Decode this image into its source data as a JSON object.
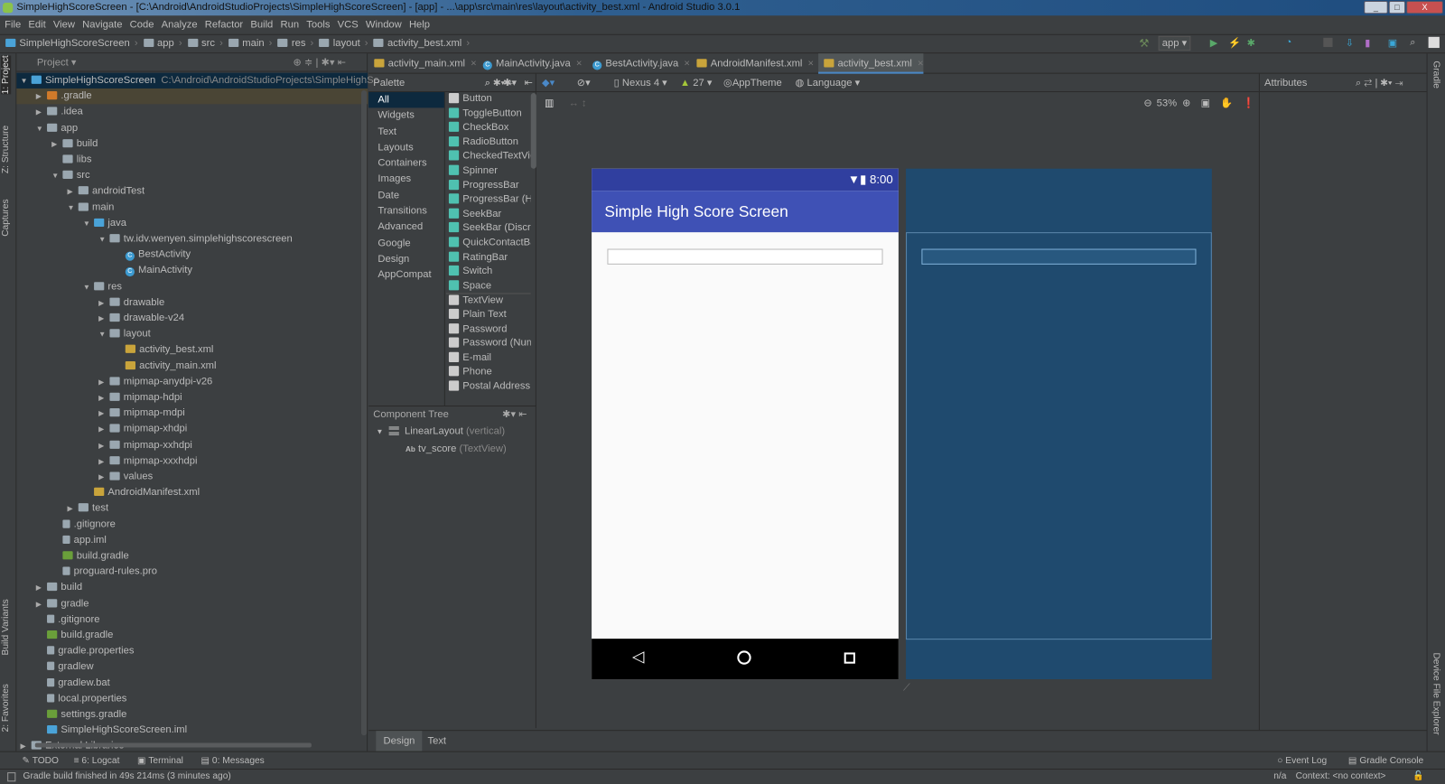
{
  "window": {
    "title": "SimpleHighScoreScreen - [C:\\Android\\AndroidStudioProjects\\SimpleHighScoreScreen] - [app] - ...\\app\\src\\main\\res\\layout\\activity_best.xml - Android Studio 3.0.1",
    "min": "_",
    "max": "□",
    "close": "X"
  },
  "menu": [
    "File",
    "Edit",
    "View",
    "Navigate",
    "Code",
    "Analyze",
    "Refactor",
    "Build",
    "Run",
    "Tools",
    "VCS",
    "Window",
    "Help"
  ],
  "breadcrumb": [
    "SimpleHighScoreScreen",
    "app",
    "src",
    "main",
    "res",
    "layout",
    "activity_best.xml"
  ],
  "toolbar": {
    "run_config": "app ▾"
  },
  "left_stripe": {
    "project": "1: Project",
    "structure": "Z: Structure",
    "captures": "Captures",
    "build_variants": "Build Variants",
    "favorites": "2: Favorites"
  },
  "right_stripe": {
    "gradle": "Gradle",
    "device_file_explorer": "Device File Explorer"
  },
  "project_panel": {
    "title": "Project ▾",
    "tree": [
      {
        "level": 0,
        "tw": "▼",
        "icon": "module",
        "label": "SimpleHighScoreScreen",
        "path": "C:\\Android\\AndroidStudioProjects\\SimpleHighSc",
        "sel": true
      },
      {
        "level": 1,
        "tw": "▶",
        "icon": "folder-orange",
        "label": ".gradle",
        "hl": true
      },
      {
        "level": 1,
        "tw": "▶",
        "icon": "folder",
        "label": ".idea"
      },
      {
        "level": 1,
        "tw": "▼",
        "icon": "folder",
        "label": "app"
      },
      {
        "level": 2,
        "tw": "▶",
        "icon": "folder",
        "label": "build"
      },
      {
        "level": 2,
        "tw": "",
        "icon": "folder",
        "label": "libs"
      },
      {
        "level": 2,
        "tw": "▼",
        "icon": "folder",
        "label": "src"
      },
      {
        "level": 3,
        "tw": "▶",
        "icon": "folder",
        "label": "androidTest"
      },
      {
        "level": 3,
        "tw": "▼",
        "icon": "folder",
        "label": "main"
      },
      {
        "level": 4,
        "tw": "▼",
        "icon": "folder-blue",
        "label": "java"
      },
      {
        "level": 5,
        "tw": "▼",
        "icon": "folder",
        "label": "tw.idv.wenyen.simplehighscorescreen"
      },
      {
        "level": 6,
        "tw": "",
        "icon": "class",
        "label": "BestActivity"
      },
      {
        "level": 6,
        "tw": "",
        "icon": "class",
        "label": "MainActivity"
      },
      {
        "level": 4,
        "tw": "▼",
        "icon": "folder",
        "label": "res"
      },
      {
        "level": 5,
        "tw": "▶",
        "icon": "folder",
        "label": "drawable"
      },
      {
        "level": 5,
        "tw": "▶",
        "icon": "folder",
        "label": "drawable-v24"
      },
      {
        "level": 5,
        "tw": "▼",
        "icon": "folder",
        "label": "layout"
      },
      {
        "level": 6,
        "tw": "",
        "icon": "xml",
        "label": "activity_best.xml"
      },
      {
        "level": 6,
        "tw": "",
        "icon": "xml",
        "label": "activity_main.xml"
      },
      {
        "level": 5,
        "tw": "▶",
        "icon": "folder",
        "label": "mipmap-anydpi-v26"
      },
      {
        "level": 5,
        "tw": "▶",
        "icon": "folder",
        "label": "mipmap-hdpi"
      },
      {
        "level": 5,
        "tw": "▶",
        "icon": "folder",
        "label": "mipmap-mdpi"
      },
      {
        "level": 5,
        "tw": "▶",
        "icon": "folder",
        "label": "mipmap-xhdpi"
      },
      {
        "level": 5,
        "tw": "▶",
        "icon": "folder",
        "label": "mipmap-xxhdpi"
      },
      {
        "level": 5,
        "tw": "▶",
        "icon": "folder",
        "label": "mipmap-xxxhdpi"
      },
      {
        "level": 5,
        "tw": "▶",
        "icon": "folder",
        "label": "values"
      },
      {
        "level": 4,
        "tw": "",
        "icon": "xml",
        "label": "AndroidManifest.xml"
      },
      {
        "level": 3,
        "tw": "▶",
        "icon": "folder",
        "label": "test"
      },
      {
        "level": 2,
        "tw": "",
        "icon": "file",
        "label": ".gitignore"
      },
      {
        "level": 2,
        "tw": "",
        "icon": "file",
        "label": "app.iml"
      },
      {
        "level": 2,
        "tw": "",
        "icon": "gradle",
        "label": "build.gradle"
      },
      {
        "level": 2,
        "tw": "",
        "icon": "file",
        "label": "proguard-rules.pro"
      },
      {
        "level": 1,
        "tw": "▶",
        "icon": "folder",
        "label": "build"
      },
      {
        "level": 1,
        "tw": "▶",
        "icon": "folder",
        "label": "gradle"
      },
      {
        "level": 1,
        "tw": "",
        "icon": "file",
        "label": ".gitignore"
      },
      {
        "level": 1,
        "tw": "",
        "icon": "gradle",
        "label": "build.gradle"
      },
      {
        "level": 1,
        "tw": "",
        "icon": "file",
        "label": "gradle.properties"
      },
      {
        "level": 1,
        "tw": "",
        "icon": "file",
        "label": "gradlew"
      },
      {
        "level": 1,
        "tw": "",
        "icon": "file",
        "label": "gradlew.bat"
      },
      {
        "level": 1,
        "tw": "",
        "icon": "file",
        "label": "local.properties"
      },
      {
        "level": 1,
        "tw": "",
        "icon": "gradle",
        "label": "settings.gradle"
      },
      {
        "level": 1,
        "tw": "",
        "icon": "module",
        "label": "SimpleHighScoreScreen.iml"
      },
      {
        "level": 0,
        "tw": "▶",
        "icon": "lib",
        "label": "External Libraries"
      }
    ]
  },
  "editor_tabs": [
    {
      "label": "activity_main.xml",
      "x": "×"
    },
    {
      "label": "MainActivity.java",
      "x": "×"
    },
    {
      "label": "BestActivity.java",
      "x": "×"
    },
    {
      "label": "AndroidManifest.xml",
      "x": "×"
    },
    {
      "label": "activity_best.xml",
      "x": "×",
      "active": true
    }
  ],
  "palette": {
    "title": "Palette",
    "categories": [
      "All",
      "Widgets",
      "Text",
      "Layouts",
      "Containers",
      "Images",
      "Date",
      "Transitions",
      "Advanced",
      "Google",
      "Design",
      "AppCompat"
    ],
    "items": [
      "Button",
      "ToggleButton",
      "CheckBox",
      "RadioButton",
      "CheckedTextView",
      "Spinner",
      "ProgressBar",
      "ProgressBar (Horizontal)",
      "SeekBar",
      "SeekBar (Discrete)",
      "QuickContactBadge",
      "RatingBar",
      "Switch",
      "Space",
      "TextView",
      "Plain Text",
      "Password",
      "Password (Numeric)",
      "E-mail",
      "Phone",
      "Postal Address"
    ]
  },
  "component_tree": {
    "title": "Component Tree",
    "root": "LinearLayout",
    "root_hint": "(vertical)",
    "child": "tv_score",
    "child_hint": "(TextView)",
    "child_icon": "Ab"
  },
  "design_toolbar": {
    "device": "Nexus 4 ▾",
    "api": "27 ▾",
    "theme": "AppTheme",
    "language": "Language ▾",
    "zoom": "53%"
  },
  "phone": {
    "time": "8:00",
    "app_title": "Simple High Score Screen"
  },
  "attributes": {
    "title": "Attributes"
  },
  "design_tabs": [
    "Design",
    "Text"
  ],
  "bottom_tools": [
    "TODO",
    "6: Logcat",
    "Terminal",
    "0: Messages",
    "Event Log",
    "Gradle Console"
  ],
  "status": {
    "message": "Gradle build finished in 49s 214ms (3 minutes ago)",
    "position": "n/a",
    "context": "Context: <no context>"
  }
}
